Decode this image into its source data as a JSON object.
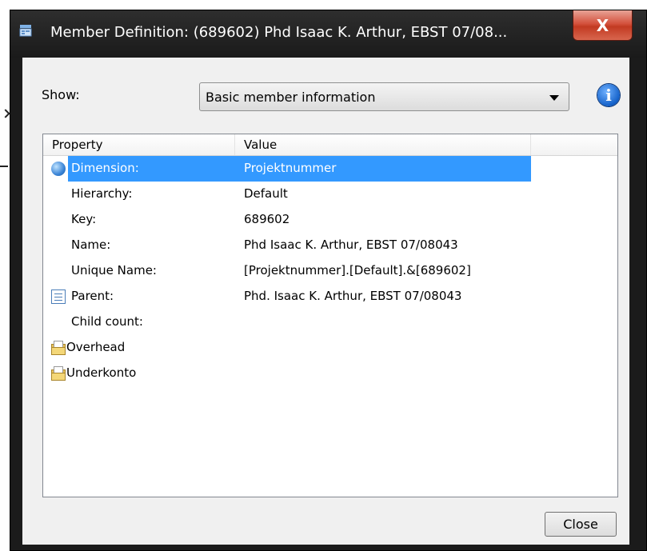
{
  "window": {
    "title": "Member Definition: (689602) Phd Isaac K. Arthur, EBST 07/08...",
    "close_glyph": "X"
  },
  "show": {
    "label": "Show:",
    "selected": "Basic member information",
    "info_glyph": "i"
  },
  "table": {
    "columns": [
      "Property",
      "Value",
      ""
    ],
    "rows": [
      {
        "icon": "globe-icon",
        "property": "Dimension:",
        "value": "Projektnummer",
        "selected": true
      },
      {
        "icon": "",
        "property": "Hierarchy:",
        "value": "Default"
      },
      {
        "icon": "",
        "property": "Key:",
        "value": "689602"
      },
      {
        "icon": "",
        "property": "Name:",
        "value": "Phd Isaac K. Arthur, EBST 07/08043"
      },
      {
        "icon": "",
        "property": "Unique Name:",
        "value": "[Projektnummer].[Default].&[689602]"
      },
      {
        "icon": "document-icon",
        "property": "Parent:",
        "value": "Phd. Isaac K. Arthur, EBST 07/08043"
      },
      {
        "icon": "",
        "property": "Child count:",
        "value": ""
      },
      {
        "icon": "folder-icon",
        "property": "Overhead",
        "value": ""
      },
      {
        "icon": "folder-icon",
        "property": "Underkonto",
        "value": ""
      }
    ]
  },
  "buttons": {
    "close": "Close"
  },
  "colors": {
    "selection": "#3399ff",
    "titlebar": "#1b1b1b",
    "close_button": "#c8432b"
  }
}
